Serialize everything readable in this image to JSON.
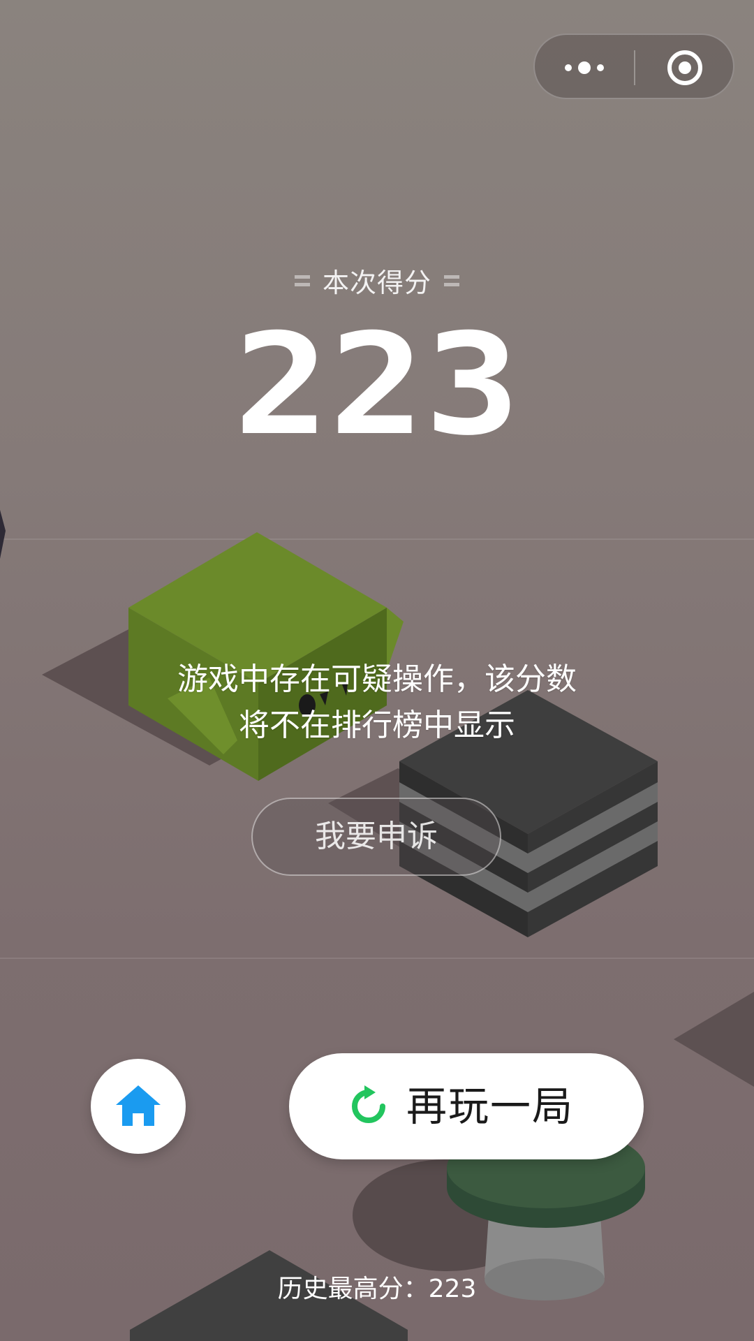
{
  "header": {
    "score_label": "本次得分",
    "score": "223"
  },
  "warning": {
    "line1": "游戏中存在可疑操作，该分数",
    "line2": "将不在排行榜中显示"
  },
  "appeal_button": {
    "label": "我要申诉"
  },
  "replay_button": {
    "label": "再玩一局"
  },
  "home_button": {
    "icon": "home-icon"
  },
  "best_score": {
    "text": "历史最高分：223"
  },
  "colors": {
    "accent_blue": "#1a9bf0",
    "accent_green": "#22c55e",
    "block_green": "#6b8a2a",
    "block_dark": "#3e3e3e"
  }
}
